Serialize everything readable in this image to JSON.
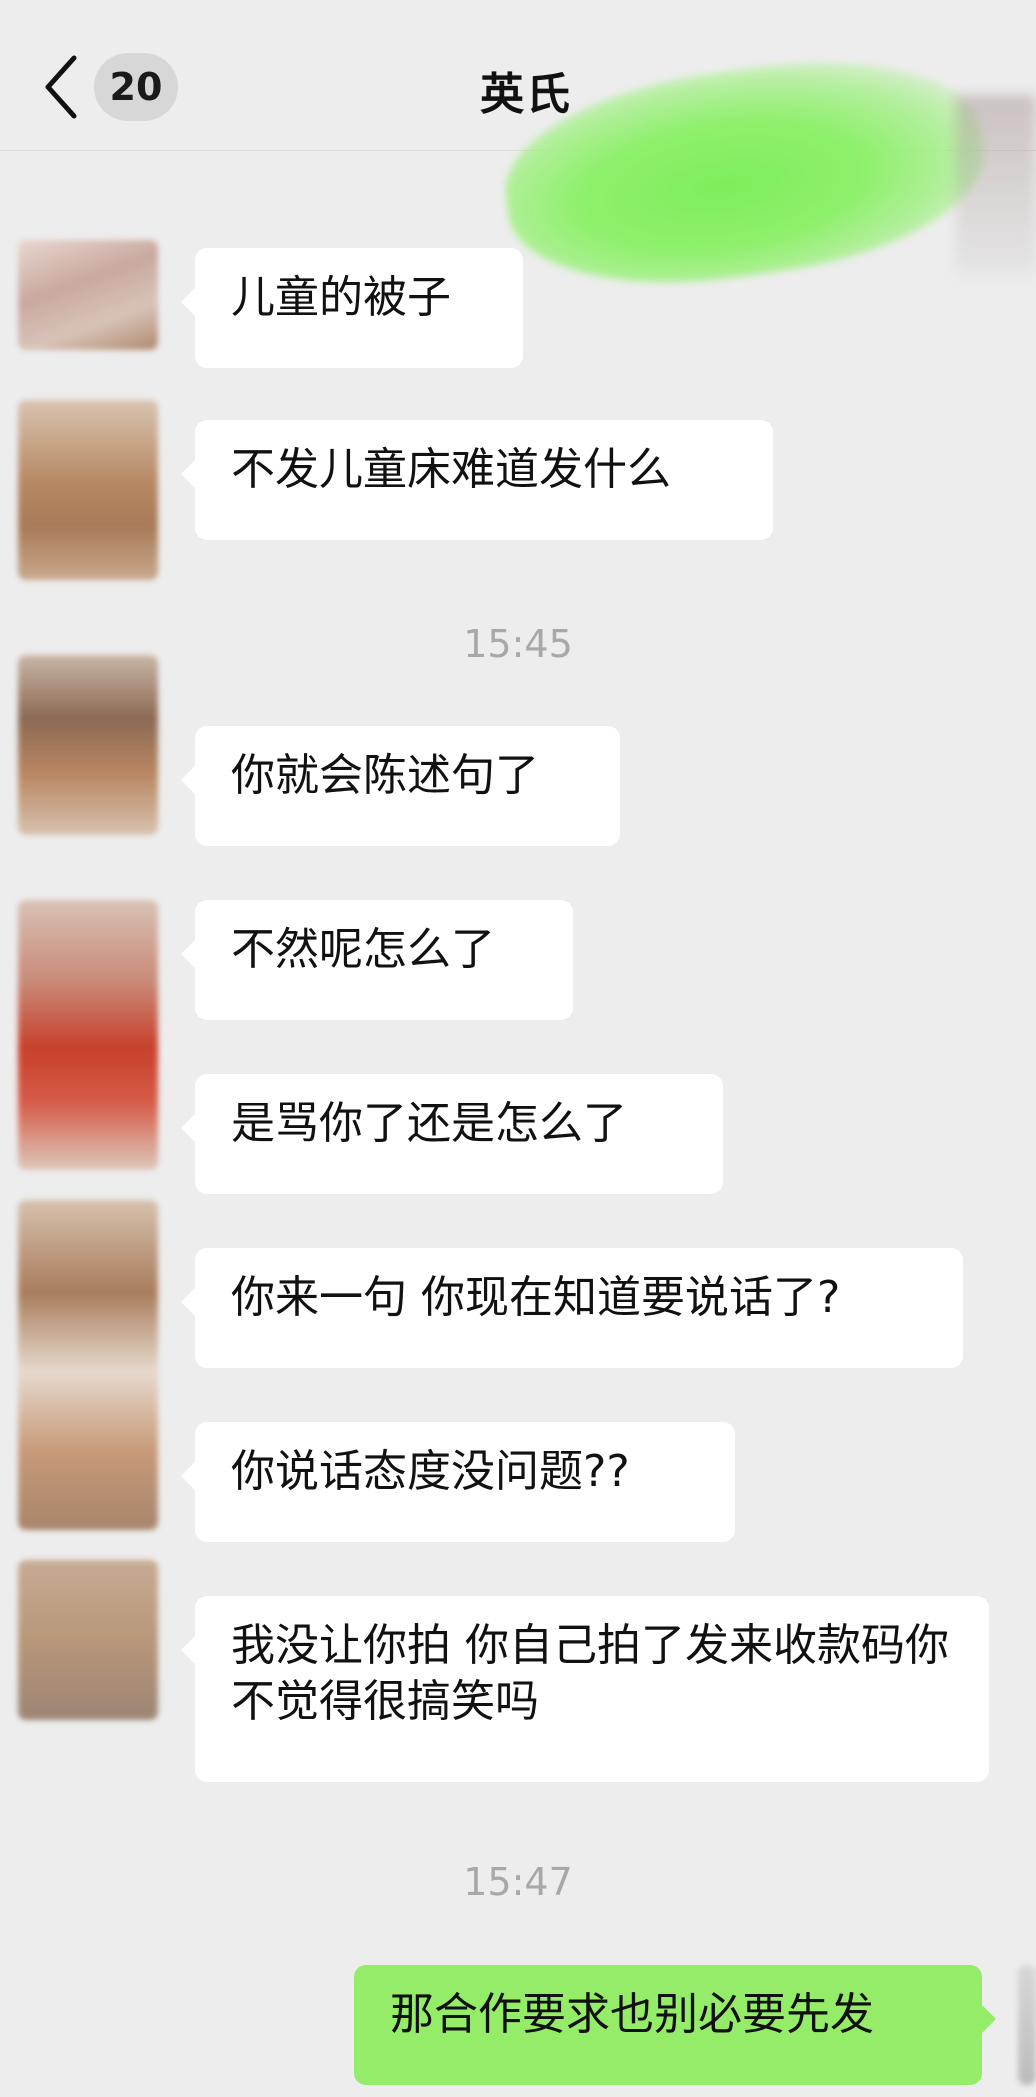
{
  "header": {
    "back_icon": "chevron-left-icon",
    "unread_count": "20",
    "title": "英氏"
  },
  "colors": {
    "background": "#ededed",
    "incoming_bubble": "#ffffff",
    "outgoing_bubble": "#95ec69",
    "timestamp": "#a8a8a8"
  },
  "messages": [
    {
      "text": "儿童的被子",
      "direction": "incoming"
    },
    {
      "text": "不发儿童床难道发什么",
      "direction": "incoming"
    },
    {
      "text": "15:45",
      "direction": "time"
    },
    {
      "text": "你就会陈述句了",
      "direction": "incoming"
    },
    {
      "text": "不然呢怎么了",
      "direction": "incoming"
    },
    {
      "text": "是骂你了还是怎么了",
      "direction": "incoming"
    },
    {
      "text": "你来一句 你现在知道要说话了?",
      "direction": "incoming"
    },
    {
      "text": "你说话态度没问题??",
      "direction": "incoming"
    },
    {
      "text": "我没让你拍 你自己拍了发来收款码你不觉得很搞笑吗",
      "direction": "incoming"
    },
    {
      "text": "15:47",
      "direction": "time"
    },
    {
      "text": "那合作要求也别必要先发",
      "direction": "outgoing"
    }
  ]
}
